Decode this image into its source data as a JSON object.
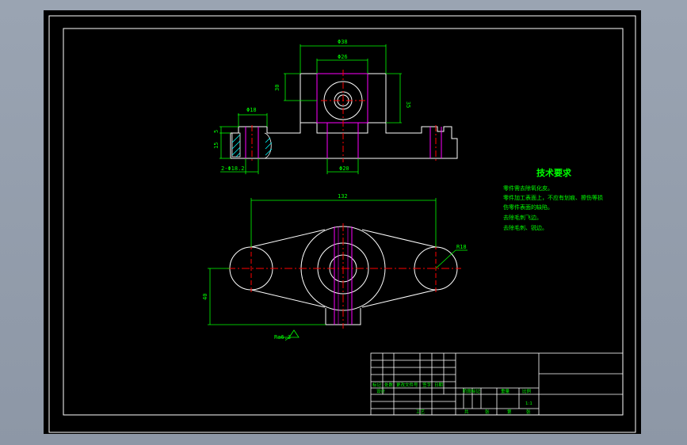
{
  "drawing": {
    "dims": {
      "top_width_outer": "Φ38",
      "top_width_inner": "Φ26",
      "top_left_height": "30",
      "top_right_height": "35",
      "left_boss_dia": "Φ18",
      "left_boss_h1": "5",
      "left_boss_h2": "15",
      "bore_bottom": "Φ20",
      "hole_note": "2-Φ18.2",
      "plan_span": "132",
      "plan_radius": "R18",
      "plan_height": "40",
      "roughness": "Ra6.3"
    },
    "tech_requirements": {
      "title": "技术要求",
      "lines": [
        "零件需去除氧化皮。",
        "零件加工表面上，不应有划痕、擦伤等损",
        "伤零件表面的缺陷。",
        "去除毛刺飞边。",
        "去除毛刺、锐边。"
      ]
    },
    "title_block": {
      "labels_row": [
        "标记",
        "处数",
        "更改文件号",
        "签字",
        "日期"
      ],
      "design": "设计",
      "stage_headers": [
        "阶段标记",
        "重量",
        "比例"
      ],
      "scale": "1:1",
      "process": "工艺",
      "bottom": [
        "共",
        "张",
        "第",
        "张"
      ]
    },
    "colors": {
      "background": "#000000",
      "outline": "#ffffff",
      "dimension": "#00ff00",
      "centerline": "#ff0000",
      "hidden": "#ff00ff",
      "hatch": "#00ffff"
    }
  }
}
